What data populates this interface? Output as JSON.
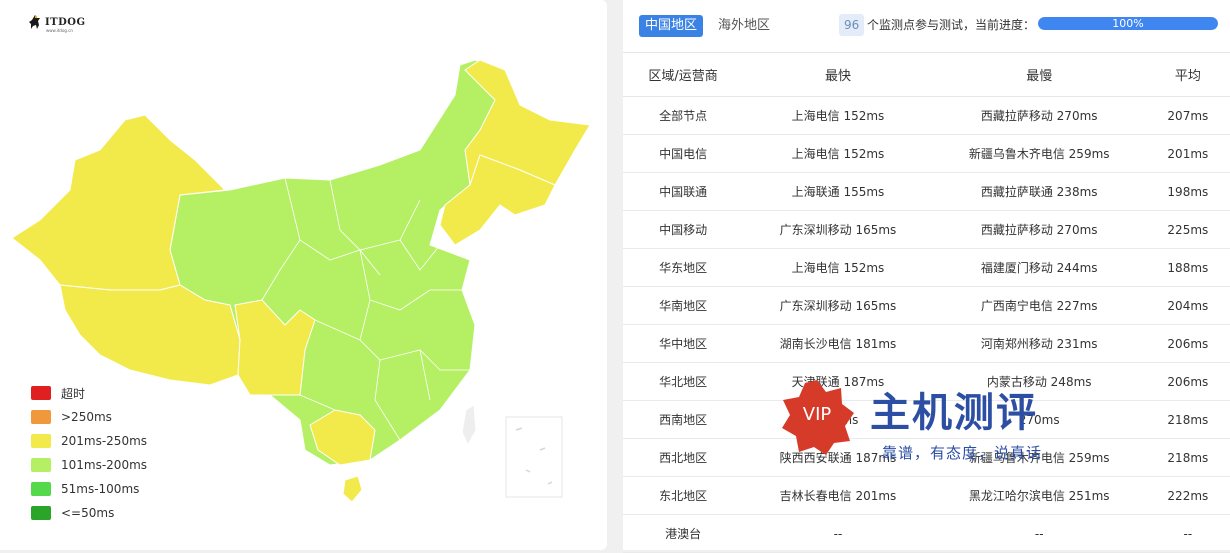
{
  "logo": {
    "text": "ITDOG",
    "subtext": "www.itdog.cn"
  },
  "legend": [
    {
      "label": "超时",
      "color": "#e02020"
    },
    {
      "label": ">250ms",
      "color": "#f0993c"
    },
    {
      "label": "201ms-250ms",
      "color": "#f2ea4a"
    },
    {
      "label": "101ms-200ms",
      "color": "#b5f064"
    },
    {
      "label": "51ms-100ms",
      "color": "#55d94a"
    },
    {
      "label": "<=50ms",
      "color": "#2aa52a"
    }
  ],
  "tabs": {
    "china": "中国地区",
    "overseas": "海外地区"
  },
  "progress": {
    "count": "96",
    "text": "个监测点参与测试，当前进度：",
    "percent_label": "100%",
    "value": 1.0
  },
  "table": {
    "headers": [
      "区域/运营商",
      "最快",
      "最慢",
      "平均"
    ],
    "rows": [
      [
        "全部节点",
        "上海电信 152ms",
        "西藏拉萨移动 270ms",
        "207ms"
      ],
      [
        "中国电信",
        "上海电信 152ms",
        "新疆乌鲁木齐电信 259ms",
        "201ms"
      ],
      [
        "中国联通",
        "上海联通 155ms",
        "西藏拉萨联通 238ms",
        "198ms"
      ],
      [
        "中国移动",
        "广东深圳移动 165ms",
        "西藏拉萨移动 270ms",
        "225ms"
      ],
      [
        "华东地区",
        "上海电信 152ms",
        "福建厦门移动 244ms",
        "188ms"
      ],
      [
        "华南地区",
        "广东深圳移动 165ms",
        "广西南宁电信 227ms",
        "204ms"
      ],
      [
        "华中地区",
        "湖南长沙电信 181ms",
        "河南郑州移动 231ms",
        "206ms"
      ],
      [
        "华北地区",
        "天津联通 187ms",
        "内蒙古移动 248ms",
        "206ms"
      ],
      [
        "西南地区",
        "195ms",
        "270ms",
        "218ms"
      ],
      [
        "西北地区",
        "陕西西安联通 187ms",
        "新疆乌鲁木齐电信 259ms",
        "218ms"
      ],
      [
        "东北地区",
        "吉林长春电信 201ms",
        "黑龙江哈尔滨电信 251ms",
        "222ms"
      ],
      [
        "港澳台",
        "--",
        "--",
        "--"
      ]
    ]
  },
  "watermark": {
    "badge": "VIP",
    "title": "主机测评",
    "subtitle": "靠谱，有态度，说真话"
  },
  "colors": {
    "accent": "#3a82e4",
    "yellow": "#f2ea4a",
    "lightgreen": "#b5f064",
    "border": "#e6e6e6"
  }
}
